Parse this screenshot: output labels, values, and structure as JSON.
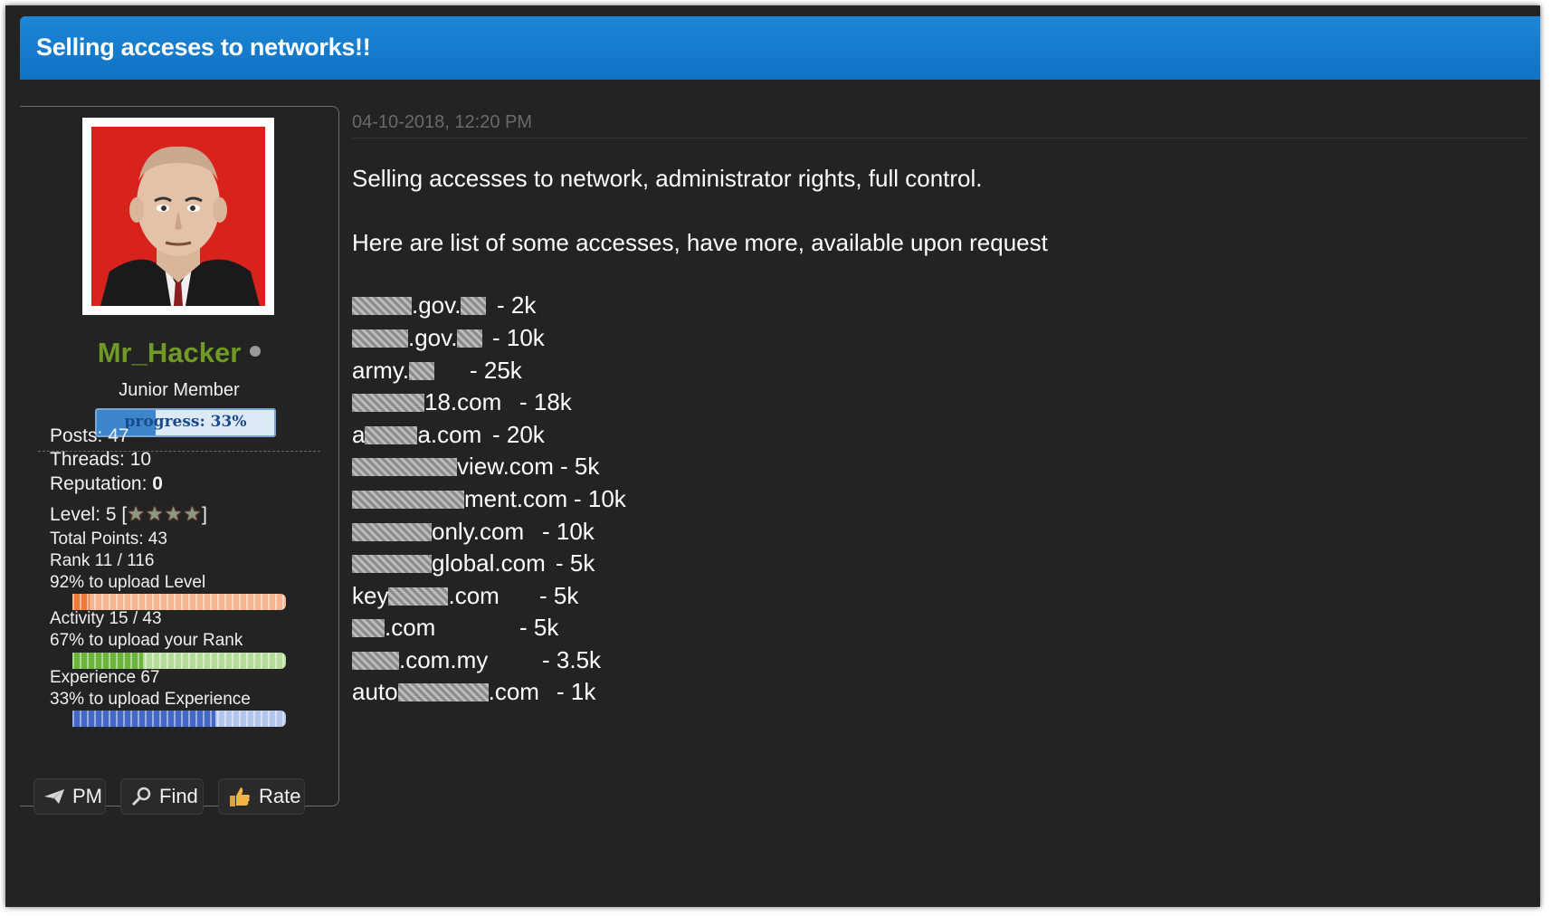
{
  "thread": {
    "title": "Selling acceses to networks!!"
  },
  "user": {
    "name": "Mr_Hacker",
    "title": "Junior Member",
    "progress_label": "progress: 33%",
    "progress_pct": 33,
    "name_color": "#6f9a25"
  },
  "stats": {
    "posts": "Posts: 47",
    "threads": "Threads: 10",
    "reputation_label": "Reputation: ",
    "reputation_value": "0",
    "level_label": "Level: 5 [",
    "level_close": "]",
    "level_stars": 4,
    "total_points": "Total Points: 43",
    "rank": "Rank 11 / 116",
    "level_upload": "92% to upload Level",
    "level_bar_pct": 8,
    "activity": "Activity 15 / 43",
    "rank_upload": "67% to upload your Rank",
    "rank_bar_pct": 33,
    "experience": "Experience 67",
    "exp_upload": "33% to upload Experience",
    "exp_bar_pct": 67
  },
  "post": {
    "date": "04-10-2018, 12:20 PM",
    "line1": "Selling accesses to network, administrator rights, full control.",
    "line2": "Here are list of some accesses, have more, available upon request",
    "accesses": [
      {
        "prefix": "",
        "suffix": ".gov.",
        "tail": "",
        "price": "- 2k"
      },
      {
        "prefix": "",
        "suffix": ".gov.",
        "tail": "",
        "price": "- 10k"
      },
      {
        "prefix": "army.",
        "suffix": "",
        "tail": "",
        "price": "- 25k"
      },
      {
        "prefix": "",
        "suffix": "18.com",
        "tail": "",
        "price": "- 18k"
      },
      {
        "prefix": "a",
        "suffix": "a.com",
        "tail": "",
        "price": "- 20k"
      },
      {
        "prefix": "",
        "suffix": "view.com",
        "tail": "",
        "price": "- 5k"
      },
      {
        "prefix": "",
        "suffix": "ment.com",
        "tail": "",
        "price": "- 10k"
      },
      {
        "prefix": "",
        "suffix": "only.com",
        "tail": "",
        "price": "- 10k"
      },
      {
        "prefix": "",
        "suffix": "global.com",
        "tail": "",
        "price": "- 5k"
      },
      {
        "prefix": "key",
        "suffix": ".com",
        "tail": "",
        "price": "- 5k"
      },
      {
        "prefix": "",
        "suffix": ".com",
        "tail": "",
        "price": "- 5k"
      },
      {
        "prefix": "",
        "suffix": ".com.my",
        "tail": "",
        "price": "- 3.5k"
      },
      {
        "prefix": "auto",
        "suffix": ".com",
        "tail": "",
        "price": "- 1k"
      }
    ]
  },
  "buttons": {
    "pm": "PM",
    "find": "Find",
    "rate": "Rate"
  }
}
